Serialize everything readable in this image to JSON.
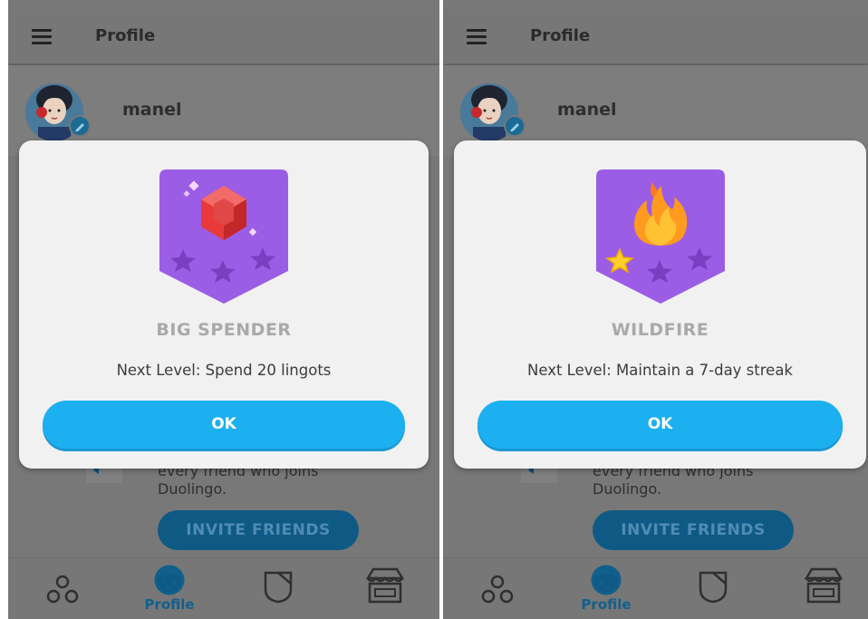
{
  "left": {
    "header": {
      "title": "Profile"
    },
    "user": {
      "name": "manel"
    },
    "modal": {
      "badge_title": "BIG SPENDER",
      "description": "Next Level: Spend 20 lingots",
      "ok_label": "OK",
      "badge_icon": "gem-icon",
      "stars_filled": 0,
      "stars_total": 3
    },
    "background": {
      "invite_line1": "every friend who joins",
      "invite_line2": "Duolingo.",
      "invite_button": "INVITE FRIENDS"
    },
    "tabbar": {
      "active_label": "Profile"
    }
  },
  "right": {
    "header": {
      "title": "Profile"
    },
    "user": {
      "name": "manel"
    },
    "modal": {
      "badge_title": "WILDFIRE",
      "description": "Next Level: Maintain a 7-day streak",
      "ok_label": "OK",
      "badge_icon": "fire-icon",
      "stars_filled": 1,
      "stars_total": 3
    },
    "background": {
      "invite_line1": "every friend who joins",
      "invite_line2": "Duolingo.",
      "invite_button": "INVITE FRIENDS"
    },
    "tabbar": {
      "active_label": "Profile"
    }
  },
  "colors": {
    "badge_purple": "#9b5de5",
    "ok_button": "#1cb0f0",
    "accent_blue": "#11608c"
  }
}
